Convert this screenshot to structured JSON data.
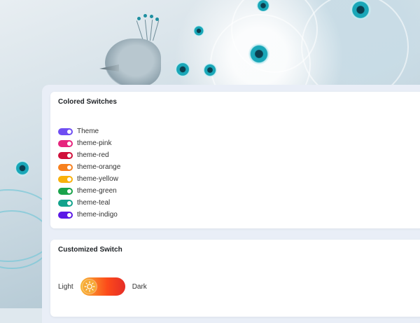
{
  "colored_switches": {
    "title": "Colored Switches",
    "items": [
      {
        "label": "Theme",
        "color": "#6f4ef2"
      },
      {
        "label": "theme-pink",
        "color": "#e6247d"
      },
      {
        "label": "theme-red",
        "color": "#d0103a"
      },
      {
        "label": "theme-orange",
        "color": "#f7801e"
      },
      {
        "label": "theme-yellow",
        "color": "#f9b10a"
      },
      {
        "label": "theme-green",
        "color": "#1aa34a"
      },
      {
        "label": "theme-teal",
        "color": "#12a38c"
      },
      {
        "label": "theme-indigo",
        "color": "#5b19e6"
      }
    ]
  },
  "customized_switch": {
    "title": "Customized Switch",
    "left_label": "Light",
    "right_label": "Dark",
    "knob_icon": "sun-icon",
    "gradient_colors": [
      "#f7b733",
      "#fc4a1a",
      "#e52d27"
    ]
  }
}
